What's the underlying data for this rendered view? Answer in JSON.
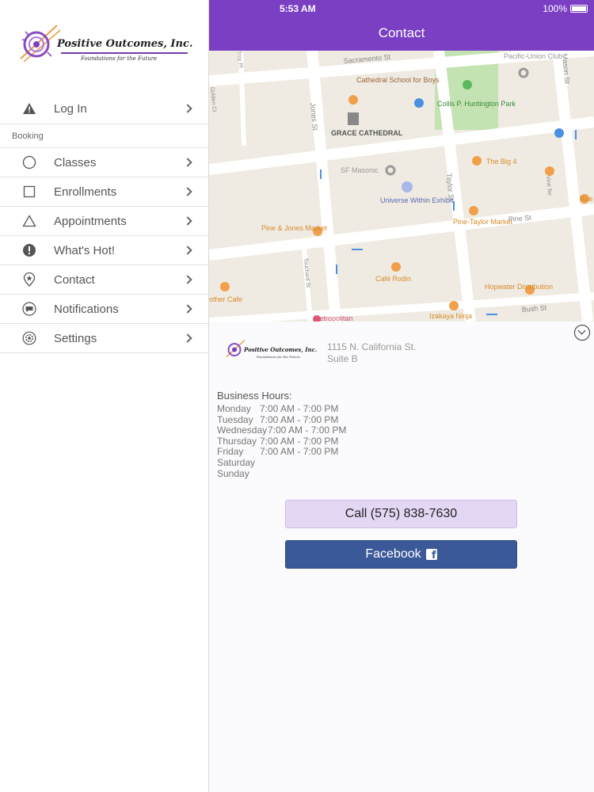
{
  "status_bar": {
    "time": "5:53 AM",
    "battery": "100%"
  },
  "nav": {
    "title": "Contact"
  },
  "brand": {
    "name": "Positive Outcomes, Inc.",
    "tagline": "Foundations for the Future"
  },
  "sidebar": {
    "login": {
      "label": "Log In",
      "icon": "warning-triangle-icon"
    },
    "section_booking": "Booking",
    "items": [
      {
        "label": "Classes",
        "icon": "circle-outline-icon"
      },
      {
        "label": "Enrollments",
        "icon": "square-outline-icon"
      },
      {
        "label": "Appointments",
        "icon": "triangle-outline-icon"
      },
      {
        "label": "What's Hot!",
        "icon": "exclamation-icon"
      },
      {
        "label": "Contact",
        "icon": "location-pin-icon"
      },
      {
        "label": "Notifications",
        "icon": "chat-bubble-icon"
      },
      {
        "label": "Settings",
        "icon": "gear-icon"
      }
    ]
  },
  "map": {
    "streets": [
      "Sacramento St",
      "Jones St",
      "Taylor St",
      "Mason St",
      "Pine St",
      "Bush St",
      "Golden Ct",
      "Vine Ter",
      "Touchard St",
      "Troy Pl"
    ],
    "places": [
      "Cathedral School for Boys",
      "GRACE CATHEDRAL",
      "Collis P. Huntington Park",
      "Pacific-Union Club",
      "SF Masonic",
      "Universe Within Exhibit",
      "The Big 4",
      "Pine & Jones Market",
      "Pine-Taylor Market",
      "Café Rodin",
      "Hopwater Distribution",
      "Izakaya Ninja",
      "Metropolitan",
      "other Cafe",
      "Rue"
    ]
  },
  "contact": {
    "address_line1": "1115 N. California St.",
    "address_line2": "Suite B",
    "hours_title": "Business Hours:",
    "hours": [
      {
        "day": "Monday",
        "time": "7:00 AM - 7:00 PM"
      },
      {
        "day": "Tuesday",
        "time": "7:00 AM - 7:00 PM"
      },
      {
        "day": "Wednesday",
        "time": "7:00 AM - 7:00 PM"
      },
      {
        "day": "Thursday",
        "time": "7:00 AM - 7:00 PM"
      },
      {
        "day": "Friday",
        "time": "7:00 AM - 7:00 PM"
      },
      {
        "day": "Saturday",
        "time": ""
      },
      {
        "day": "Sunday",
        "time": ""
      }
    ],
    "call_label": "Call (575) 838-7630",
    "facebook_label": "Facebook"
  },
  "colors": {
    "brand_purple": "#7b3fc4",
    "call_bg": "#e3d7f4",
    "facebook_blue": "#3b5998"
  }
}
